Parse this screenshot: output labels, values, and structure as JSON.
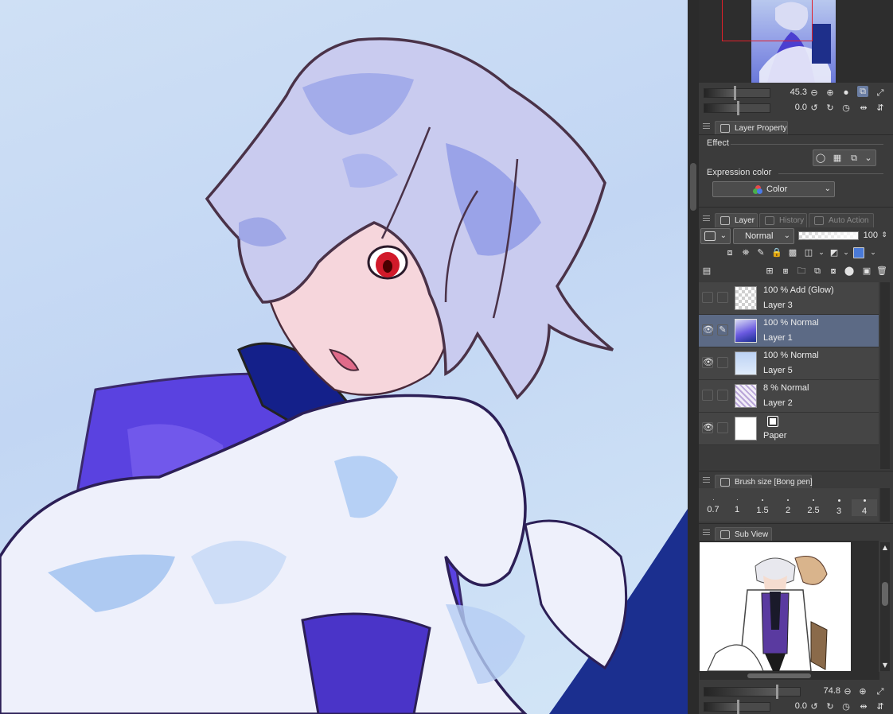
{
  "navigator": {
    "zoom_value": "45.3",
    "rotate_value": "0.0",
    "zoom_percent": 45.3
  },
  "layer_property": {
    "tab_label": "Layer Property",
    "effect_label": "Effect",
    "expression_color_label": "Expression color",
    "expression_color_value": "Color"
  },
  "layer_panel": {
    "tabs": [
      {
        "label": "Layer"
      },
      {
        "label": "History"
      },
      {
        "label": "Auto Action"
      }
    ],
    "blend_mode": "Normal",
    "opacity_value": "100",
    "opacity_percent": 100,
    "layers": [
      {
        "mode": "100 % Add (Glow)",
        "name": "Layer 3",
        "visible": false,
        "selected": false,
        "thumb": "checker"
      },
      {
        "mode": "100 % Normal",
        "name": "Layer 1",
        "visible": true,
        "selected": true,
        "thumb": "art"
      },
      {
        "mode": "100 % Normal",
        "name": "Layer 5",
        "visible": true,
        "selected": false,
        "thumb": "gradient"
      },
      {
        "mode": "8 % Normal",
        "name": "Layer 2",
        "visible": false,
        "selected": false,
        "thumb": "pattern"
      },
      {
        "mode": "",
        "name": "Paper",
        "visible": true,
        "selected": false,
        "thumb": "paper"
      }
    ]
  },
  "brush_size": {
    "tab_label": "Brush size [Bong pen]",
    "sizes": [
      "0.7",
      "1",
      "1.5",
      "2",
      "2.5",
      "3",
      "4"
    ],
    "selected": "4"
  },
  "sub_view": {
    "tab_label": "Sub View",
    "zoom_value": "74.8",
    "rotate_value": "0.0",
    "zoom_percent": 74.8
  },
  "icons": {
    "eye": "eye-icon",
    "pen": "pen-icon",
    "grip": "panel-grip-icon"
  },
  "colors": {
    "panel_bg": "#3b3b3b",
    "selection": "#5c6a85",
    "nav_frame": "#e0202a"
  }
}
